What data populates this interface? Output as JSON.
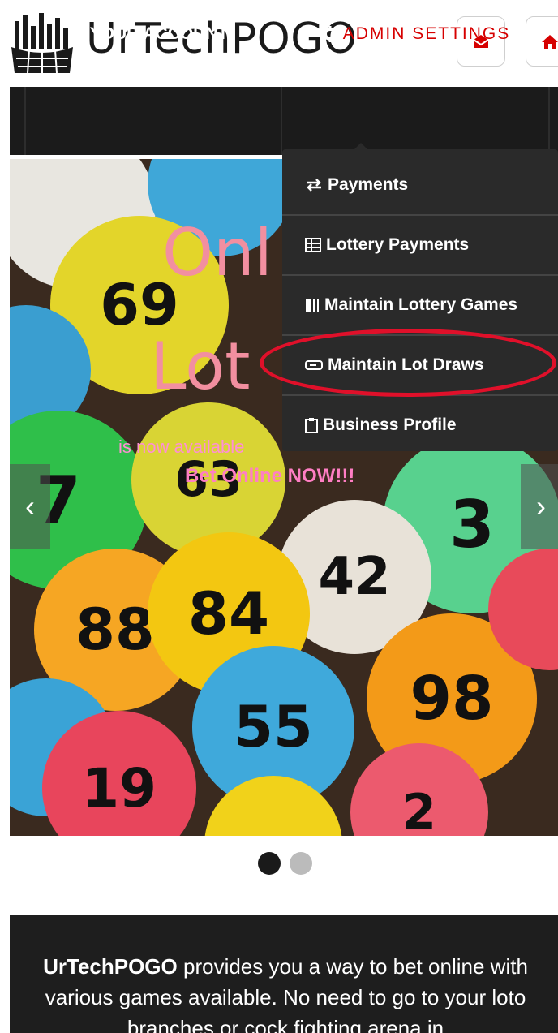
{
  "header": {
    "brand": "UrTechPOGO",
    "icons": [
      "city-logo-icon",
      "mail-icon",
      "home-icon"
    ]
  },
  "nav": {
    "account_label": "YOUR ACCOUNT",
    "admin_label": "ADMIN SETTINGS"
  },
  "dropdown": {
    "items": [
      {
        "label": "Payments",
        "icon": "exchange-icon"
      },
      {
        "label": "Lottery Payments",
        "icon": "table-icon"
      },
      {
        "label": "Maintain Lottery Games",
        "icon": "columns-icon"
      },
      {
        "label": "Maintain Lot Draws",
        "icon": "ticket-icon"
      },
      {
        "label": "Business Profile",
        "icon": "clipboard-icon"
      }
    ]
  },
  "carousel": {
    "headline_line1": "Onl",
    "headline_line2": "Lot",
    "subtext": "is now available",
    "cta": "Bet Online NOW!!!",
    "prev_glyph": "‹",
    "next_glyph": "›",
    "ball_numbers": [
      "69",
      "84",
      "88",
      "3",
      "42",
      "98",
      "19",
      "63",
      "55",
      "7",
      "2"
    ],
    "active_slide_index": 0,
    "slide_count": 2
  },
  "about": {
    "brand": "UrTechPOGO",
    "text": " provides you a way to bet online with various games available. No need to go to your loto branches or cock fighting arena in"
  },
  "colors": {
    "accent_red": "#d60000",
    "nav_bg": "#1b1b1b",
    "dropdown_bg": "#2a2a2a",
    "highlight": "#e0102a",
    "headline_pink": "#f28fa0"
  }
}
